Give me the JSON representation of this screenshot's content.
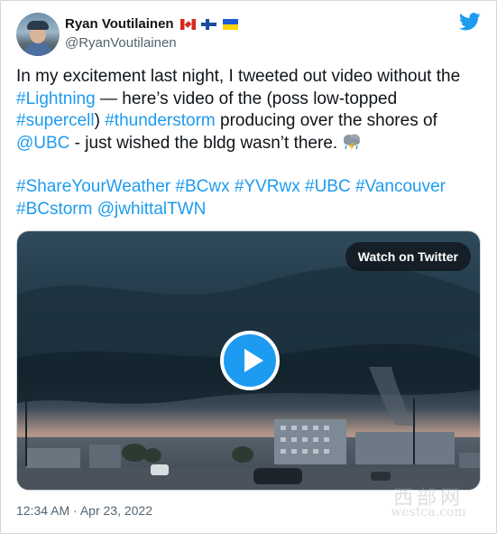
{
  "author": {
    "display_name": "Ryan Voutilainen",
    "handle": "@RyanVoutilainen",
    "flags": [
      "canada-flag",
      "finland-flag",
      "ukraine-flag"
    ]
  },
  "tweet": {
    "p1_a": "In my excitement last night, I tweeted out video without the ",
    "p1_link1": "#Lightning",
    "p1_b": " — here’s video of the (poss low-topped ",
    "p1_link2": "#supercell",
    "p1_c": ") ",
    "p1_link3": "#thunderstorm",
    "p1_d": " producing over the shores of ",
    "p1_link4": "@UBC",
    "p1_e": " - just wished the bldg wasn’t there. ",
    "emoji": "cloud-with-lightning-and-rain-emoji",
    "hashtags": [
      "#ShareYourWeather",
      "#BCwx",
      "#YVRwx",
      "#UBC",
      "#Vancouver",
      "#BCstorm",
      "@jwhittalTWN"
    ]
  },
  "media": {
    "watch_label": "Watch on Twitter"
  },
  "timestamp": "12:34 AM · Apr 23, 2022",
  "watermark": {
    "top": "西部网",
    "bottom": "westca.com"
  },
  "colors": {
    "link": "#1d9bf0",
    "text": "#0f1419",
    "muted": "#536471",
    "twitter_blue": "#1d9bf0"
  }
}
